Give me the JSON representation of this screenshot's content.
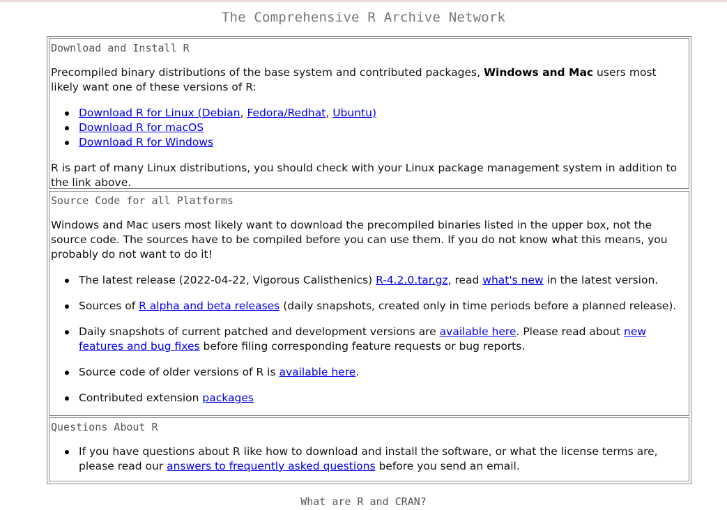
{
  "page_title": "The Comprehensive R Archive Network",
  "download_section": {
    "title": "Download and Install R",
    "intro_before_bold": "Precompiled binary distributions of the base system and contributed packages, ",
    "intro_bold": "Windows and Mac",
    "intro_after_bold": " users most likely want one of these versions of R:",
    "linux_link": "Download R for Linux",
    "linux_paren_open": " (",
    "debian_link": "Debian",
    "sep1": ", ",
    "fedora_link": "Fedora/Redhat",
    "sep2": ", ",
    "ubuntu_link": "Ubuntu",
    "paren_close": ")",
    "macos_link": "Download R for macOS",
    "windows_link": "Download R for Windows",
    "note": "R is part of many Linux distributions, you should check with your Linux package management system in addition to the link above."
  },
  "source_section": {
    "title": "Source Code for all Platforms",
    "intro": "Windows and Mac users most likely want to download the precompiled binaries listed in the upper box, not the source code. The sources have to be compiled before you can use them. If you do not know what this means, you probably do not want to do it!",
    "latest_prefix": "The latest release (2022-04-22, Vigorous Calisthenics) ",
    "latest_link": "R-4.2.0.tar.gz",
    "latest_mid": ", read ",
    "whatsnew_link": "what's new",
    "latest_suffix": " in the latest version.",
    "alpha_prefix": "Sources of ",
    "alpha_link": "R alpha and beta releases",
    "alpha_suffix": " (daily snapshots, created only in time periods before a planned release).",
    "daily_prefix": "Daily snapshots of current patched and development versions are ",
    "daily_link": "available here",
    "daily_mid": ". Please read about ",
    "newfeatures_link": "new features and bug fixes",
    "daily_suffix": " before filing corresponding feature requests or bug reports.",
    "older_prefix": "Source code of older versions of R is ",
    "older_link": "available here",
    "older_suffix": ".",
    "contrib_prefix": "Contributed extension ",
    "contrib_link": "packages"
  },
  "questions_section": {
    "title": "Questions About R",
    "text_prefix": "If you have questions about R like how to download and install the software, or what the license terms are, please read our ",
    "faq_link": "answers to frequently asked questions",
    "text_suffix": " before you send an email."
  },
  "footer_heading": "What are R and CRAN?"
}
